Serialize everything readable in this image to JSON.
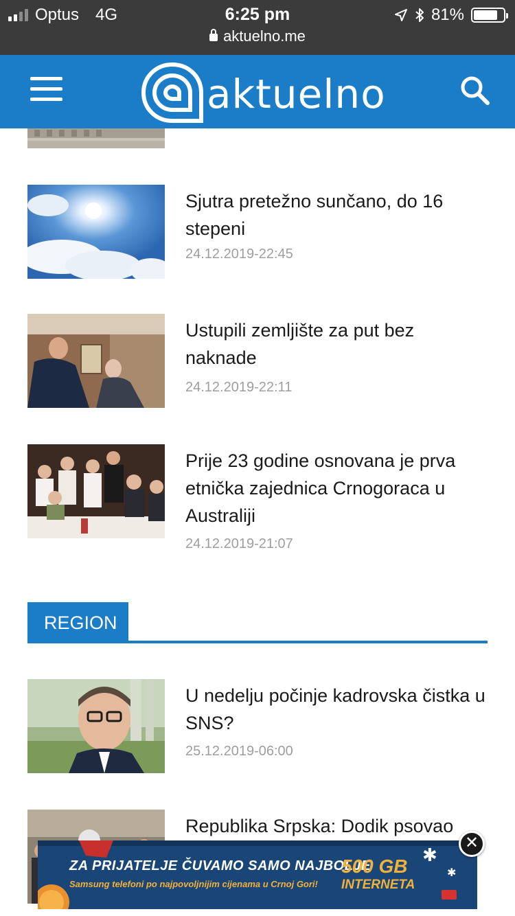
{
  "status_bar": {
    "carrier": "Optus",
    "network": "4G",
    "time": "6:25 pm",
    "battery": "81%",
    "battery_level": 0.81,
    "url": "aktuelno.me"
  },
  "header": {
    "logo_text": "aktuelno",
    "brand_color": "#1b7dc8"
  },
  "articles_top": [
    {
      "title": "Sjutra pretežno sunčano, do 16 stepeni",
      "date": "24.12.2019-22:45"
    },
    {
      "title": "Ustupili zemljište za put bez naknade",
      "date": "24.12.2019-22:11"
    },
    {
      "title": "Prije 23 godine osnovana je prva etnička zajednica Crnogoraca u Australiji",
      "date": "24.12.2019-21:07"
    }
  ],
  "region": {
    "label": "REGION",
    "articles": [
      {
        "title": "U nedelju počinje kadrovska čistka u SNS?",
        "date": "25.12.2019-06:00"
      },
      {
        "title": "Republika Srpska: Dodik psovao"
      }
    ]
  },
  "ad": {
    "line1": "ZA PRIJATELJE ČUVAMO SAMO NAJBOLJE",
    "line2": "Samsung telefoni po najpovoljnijim cijenama u Crnoj Gori!",
    "gb": "500 GB",
    "internet": "INTERNETA",
    "close": "✕"
  }
}
